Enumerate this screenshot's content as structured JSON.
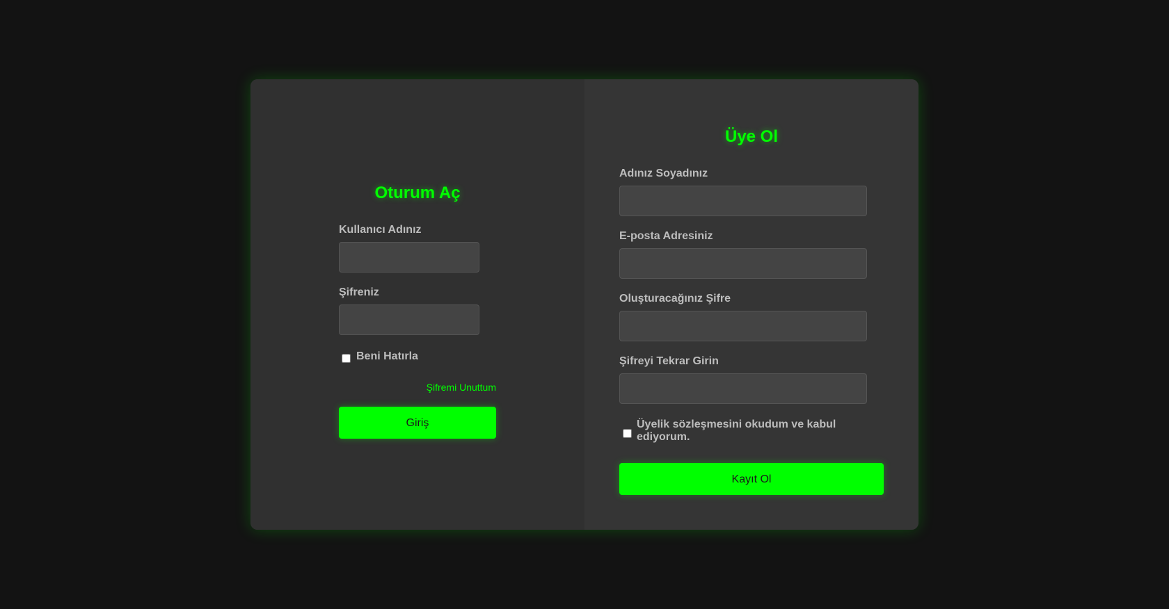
{
  "login": {
    "title": "Oturum Aç",
    "username_label": "Kullanıcı Adınız",
    "username_value": "",
    "password_label": "Şifreniz",
    "password_value": "",
    "remember_label": "Beni Hatırla",
    "forgot_link": "Şifremi Unuttum",
    "submit_label": "Giriş"
  },
  "register": {
    "title": "Üye Ol",
    "fullname_label": "Adınız Soyadınız",
    "fullname_value": "",
    "email_label": "E-posta Adresiniz",
    "email_value": "",
    "password_label": "Oluşturacağınız Şifre",
    "password_value": "",
    "password_repeat_label": "Şifreyi Tekrar Girin",
    "password_repeat_value": "",
    "terms_label": "Üyelik sözleşmesini okudum ve kabul ediyorum.",
    "submit_label": "Kayıt Ol"
  },
  "colors": {
    "accent": "#00ff00",
    "background": "#131313",
    "card": "#303030",
    "input": "#444444",
    "label": "#bdbdbd"
  }
}
